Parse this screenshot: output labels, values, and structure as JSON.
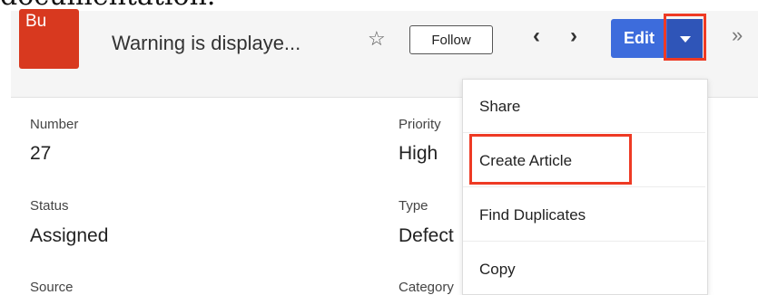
{
  "doc_snippet": "documentation.",
  "header": {
    "badge_text": "Bu",
    "record_title": "Warning is displaye...",
    "star_icon": "star-outline-icon",
    "follow_label": "Follow",
    "prev_icon": "chevron-left-icon",
    "next_icon": "chevron-right-icon",
    "edit_label": "Edit",
    "caret_icon": "caret-down-icon",
    "more_icon": "double-chevron-right-icon",
    "colors": {
      "badge": "#d8391f",
      "edit": "#3d6cdc",
      "highlight": "#ee3a24"
    }
  },
  "fields": {
    "number": {
      "label": "Number",
      "value": "27"
    },
    "priority": {
      "label": "Priority",
      "value": "High"
    },
    "status": {
      "label": "Status",
      "value": "Assigned"
    },
    "type": {
      "label": "Type",
      "value": "Defect"
    },
    "source": {
      "label": "Source"
    },
    "category": {
      "label": "Category"
    }
  },
  "dropdown": {
    "items": [
      {
        "label": "Share"
      },
      {
        "label": "Create Article"
      },
      {
        "label": "Find Duplicates"
      },
      {
        "label": "Copy"
      }
    ]
  }
}
